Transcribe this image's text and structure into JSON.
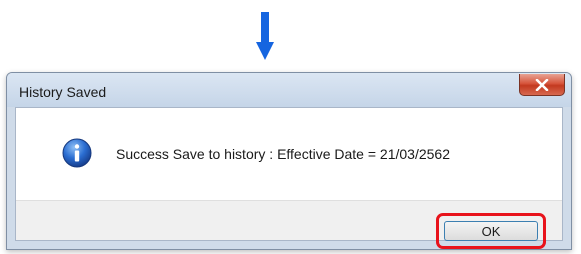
{
  "dialog": {
    "title": "History Saved",
    "message": "Success Save to history : Effective Date = 21/03/2562",
    "ok_label": "OK",
    "icon": "info-icon"
  },
  "annotations": {
    "arrow_color": "#1565e0",
    "arrow_icon": "arrow-down-icon",
    "highlight_color": "#e8131b"
  }
}
